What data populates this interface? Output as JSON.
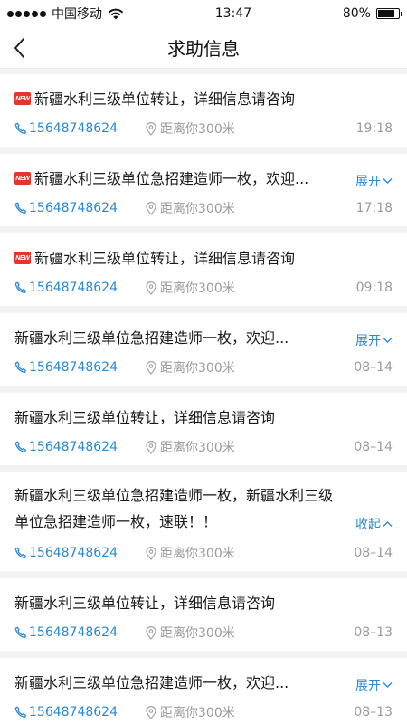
{
  "status": {
    "carrier": "中国移动",
    "time": "13:47",
    "battery": "80%",
    "battery_level": 0.8
  },
  "header": {
    "title": "求助信息"
  },
  "items": [
    {
      "is_new": true,
      "title": "新疆水利三级单位转让，详细信息请咨询",
      "phone": "15648748624",
      "distance": "距离你300米",
      "time": "19:18",
      "toggle": ""
    },
    {
      "is_new": true,
      "title": "新疆水利三级单位急招建造师一枚，欢迎...",
      "phone": "15648748624",
      "distance": "距离你300米",
      "time": "17:18",
      "toggle": "展开"
    },
    {
      "is_new": true,
      "title": "新疆水利三级单位转让，详细信息请咨询",
      "phone": "15648748624",
      "distance": "距离你300米",
      "time": "09:18",
      "toggle": ""
    },
    {
      "is_new": false,
      "title": "新疆水利三级单位急招建造师一枚，欢迎...",
      "phone": "15648748624",
      "distance": "距离你300米",
      "time": "08–14",
      "toggle": "展开"
    },
    {
      "is_new": false,
      "title": "新疆水利三级单位转让，详细信息请咨询",
      "phone": "15648748624",
      "distance": "距离你300米",
      "time": "08–14",
      "toggle": ""
    },
    {
      "is_new": false,
      "title": "新疆水利三级单位急招建造师一枚，新疆水利三级单位急招建造师一枚，速联！！",
      "phone": "15648748624",
      "distance": "距离你300米",
      "time": "08–14",
      "toggle": "收起"
    },
    {
      "is_new": false,
      "title": "新疆水利三级单位转让，详细信息请咨询",
      "phone": "15648748624",
      "distance": "距离你300米",
      "time": "08–13",
      "toggle": ""
    },
    {
      "is_new": false,
      "title": "新疆水利三级单位急招建造师一枚，欢迎...",
      "phone": "15648748624",
      "distance": "距离你300米",
      "time": "08–13",
      "toggle": "展开"
    }
  ],
  "icons": {
    "new_badge": "NEW",
    "back": "chevron-left-icon",
    "phone": "phone-icon",
    "location": "location-pin-icon",
    "expand": "chevron-down-icon",
    "collapse": "chevron-up-icon"
  },
  "colors": {
    "accent": "#2a8ad4",
    "badge": "#e8322b",
    "muted": "#9b9b9b"
  }
}
